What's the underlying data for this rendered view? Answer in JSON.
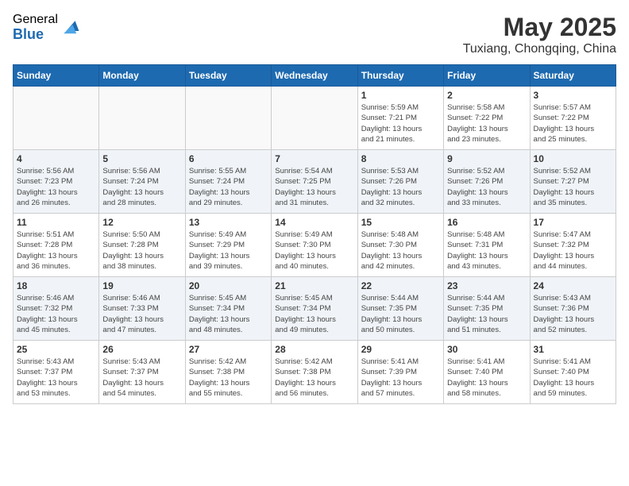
{
  "logo": {
    "general": "General",
    "blue": "Blue"
  },
  "title": "May 2025",
  "location": "Tuxiang, Chongqing, China",
  "days_of_week": [
    "Sunday",
    "Monday",
    "Tuesday",
    "Wednesday",
    "Thursday",
    "Friday",
    "Saturday"
  ],
  "weeks": [
    [
      {
        "day": "",
        "info": ""
      },
      {
        "day": "",
        "info": ""
      },
      {
        "day": "",
        "info": ""
      },
      {
        "day": "",
        "info": ""
      },
      {
        "day": "1",
        "info": "Sunrise: 5:59 AM\nSunset: 7:21 PM\nDaylight: 13 hours\nand 21 minutes."
      },
      {
        "day": "2",
        "info": "Sunrise: 5:58 AM\nSunset: 7:22 PM\nDaylight: 13 hours\nand 23 minutes."
      },
      {
        "day": "3",
        "info": "Sunrise: 5:57 AM\nSunset: 7:22 PM\nDaylight: 13 hours\nand 25 minutes."
      }
    ],
    [
      {
        "day": "4",
        "info": "Sunrise: 5:56 AM\nSunset: 7:23 PM\nDaylight: 13 hours\nand 26 minutes."
      },
      {
        "day": "5",
        "info": "Sunrise: 5:56 AM\nSunset: 7:24 PM\nDaylight: 13 hours\nand 28 minutes."
      },
      {
        "day": "6",
        "info": "Sunrise: 5:55 AM\nSunset: 7:24 PM\nDaylight: 13 hours\nand 29 minutes."
      },
      {
        "day": "7",
        "info": "Sunrise: 5:54 AM\nSunset: 7:25 PM\nDaylight: 13 hours\nand 31 minutes."
      },
      {
        "day": "8",
        "info": "Sunrise: 5:53 AM\nSunset: 7:26 PM\nDaylight: 13 hours\nand 32 minutes."
      },
      {
        "day": "9",
        "info": "Sunrise: 5:52 AM\nSunset: 7:26 PM\nDaylight: 13 hours\nand 33 minutes."
      },
      {
        "day": "10",
        "info": "Sunrise: 5:52 AM\nSunset: 7:27 PM\nDaylight: 13 hours\nand 35 minutes."
      }
    ],
    [
      {
        "day": "11",
        "info": "Sunrise: 5:51 AM\nSunset: 7:28 PM\nDaylight: 13 hours\nand 36 minutes."
      },
      {
        "day": "12",
        "info": "Sunrise: 5:50 AM\nSunset: 7:28 PM\nDaylight: 13 hours\nand 38 minutes."
      },
      {
        "day": "13",
        "info": "Sunrise: 5:49 AM\nSunset: 7:29 PM\nDaylight: 13 hours\nand 39 minutes."
      },
      {
        "day": "14",
        "info": "Sunrise: 5:49 AM\nSunset: 7:30 PM\nDaylight: 13 hours\nand 40 minutes."
      },
      {
        "day": "15",
        "info": "Sunrise: 5:48 AM\nSunset: 7:30 PM\nDaylight: 13 hours\nand 42 minutes."
      },
      {
        "day": "16",
        "info": "Sunrise: 5:48 AM\nSunset: 7:31 PM\nDaylight: 13 hours\nand 43 minutes."
      },
      {
        "day": "17",
        "info": "Sunrise: 5:47 AM\nSunset: 7:32 PM\nDaylight: 13 hours\nand 44 minutes."
      }
    ],
    [
      {
        "day": "18",
        "info": "Sunrise: 5:46 AM\nSunset: 7:32 PM\nDaylight: 13 hours\nand 45 minutes."
      },
      {
        "day": "19",
        "info": "Sunrise: 5:46 AM\nSunset: 7:33 PM\nDaylight: 13 hours\nand 47 minutes."
      },
      {
        "day": "20",
        "info": "Sunrise: 5:45 AM\nSunset: 7:34 PM\nDaylight: 13 hours\nand 48 minutes."
      },
      {
        "day": "21",
        "info": "Sunrise: 5:45 AM\nSunset: 7:34 PM\nDaylight: 13 hours\nand 49 minutes."
      },
      {
        "day": "22",
        "info": "Sunrise: 5:44 AM\nSunset: 7:35 PM\nDaylight: 13 hours\nand 50 minutes."
      },
      {
        "day": "23",
        "info": "Sunrise: 5:44 AM\nSunset: 7:35 PM\nDaylight: 13 hours\nand 51 minutes."
      },
      {
        "day": "24",
        "info": "Sunrise: 5:43 AM\nSunset: 7:36 PM\nDaylight: 13 hours\nand 52 minutes."
      }
    ],
    [
      {
        "day": "25",
        "info": "Sunrise: 5:43 AM\nSunset: 7:37 PM\nDaylight: 13 hours\nand 53 minutes."
      },
      {
        "day": "26",
        "info": "Sunrise: 5:43 AM\nSunset: 7:37 PM\nDaylight: 13 hours\nand 54 minutes."
      },
      {
        "day": "27",
        "info": "Sunrise: 5:42 AM\nSunset: 7:38 PM\nDaylight: 13 hours\nand 55 minutes."
      },
      {
        "day": "28",
        "info": "Sunrise: 5:42 AM\nSunset: 7:38 PM\nDaylight: 13 hours\nand 56 minutes."
      },
      {
        "day": "29",
        "info": "Sunrise: 5:41 AM\nSunset: 7:39 PM\nDaylight: 13 hours\nand 57 minutes."
      },
      {
        "day": "30",
        "info": "Sunrise: 5:41 AM\nSunset: 7:40 PM\nDaylight: 13 hours\nand 58 minutes."
      },
      {
        "day": "31",
        "info": "Sunrise: 5:41 AM\nSunset: 7:40 PM\nDaylight: 13 hours\nand 59 minutes."
      }
    ]
  ]
}
